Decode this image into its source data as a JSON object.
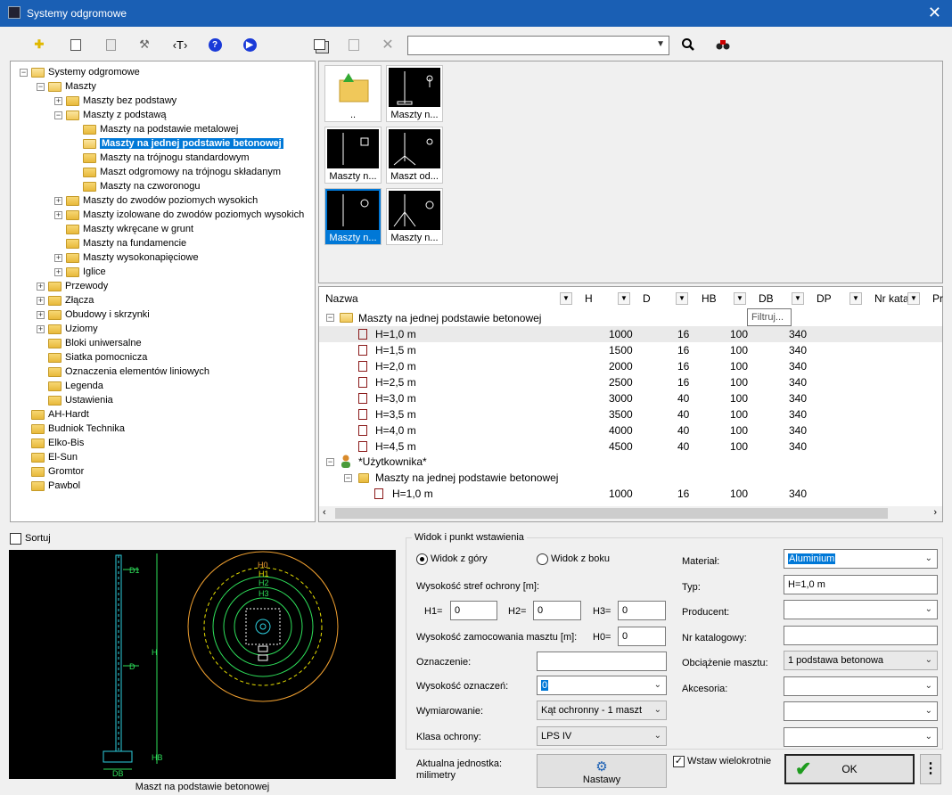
{
  "window": {
    "title": "Systemy odgromowe",
    "close": "✕"
  },
  "toolbar": {
    "add": "✚",
    "tag": "‹T›",
    "help": "?",
    "play": "▶",
    "search_value": "",
    "search_icon": "🔍",
    "binoculars": "🔭"
  },
  "tree": [
    {
      "label": "Systemy odgromowe"
    },
    {
      "label": "Maszty"
    },
    {
      "label": "Maszty bez podstawy"
    },
    {
      "label": "Maszty z podstawą"
    },
    {
      "label": "Maszty na podstawie metalowej"
    },
    {
      "label": "Maszty na jednej podstawie betonowej"
    },
    {
      "label": "Maszty na trójnogu standardowym"
    },
    {
      "label": "Maszt odgromowy na trójnogu składanym"
    },
    {
      "label": "Maszty na czworonogu"
    },
    {
      "label": "Maszty do zwodów poziomych wysokich"
    },
    {
      "label": "Maszty izolowane do zwodów poziomych wysokich"
    },
    {
      "label": "Maszty wkręcane w grunt"
    },
    {
      "label": "Maszty na fundamencie"
    },
    {
      "label": "Maszty wysokonapięciowe"
    },
    {
      "label": "Iglice"
    },
    {
      "label": "Przewody"
    },
    {
      "label": "Złącza"
    },
    {
      "label": "Obudowy i skrzynki"
    },
    {
      "label": "Uziomy"
    },
    {
      "label": "Bloki uniwersalne"
    },
    {
      "label": "Siatka pomocnicza"
    },
    {
      "label": "Oznaczenia elementów liniowych"
    },
    {
      "label": "Legenda"
    },
    {
      "label": "Ustawienia"
    },
    {
      "label": "AH-Hardt"
    },
    {
      "label": "Budniok Technika"
    },
    {
      "label": "Elko-Bis"
    },
    {
      "label": "El-Sun"
    },
    {
      "label": "Gromtor"
    },
    {
      "label": "Pawbol"
    }
  ],
  "thumbnails": [
    "..",
    "Maszty n...",
    "Maszty n...",
    "Maszt od...",
    "Maszty n...",
    "Maszty n..."
  ],
  "grid": {
    "columns": [
      "Nazwa",
      "H",
      "D",
      "HB",
      "DB",
      "DP",
      "Nr kata",
      "Pr"
    ],
    "tooltip": "Filtruj...",
    "group": "Maszty na jednej podstawie betonowej",
    "rows": [
      {
        "name": "H=1,0 m",
        "h": "1000",
        "d": "16",
        "hb": "100",
        "db": "340"
      },
      {
        "name": "H=1,5 m",
        "h": "1500",
        "d": "16",
        "hb": "100",
        "db": "340"
      },
      {
        "name": "H=2,0 m",
        "h": "2000",
        "d": "16",
        "hb": "100",
        "db": "340"
      },
      {
        "name": "H=2,5 m",
        "h": "2500",
        "d": "16",
        "hb": "100",
        "db": "340"
      },
      {
        "name": "H=3,0 m",
        "h": "3000",
        "d": "40",
        "hb": "100",
        "db": "340"
      },
      {
        "name": "H=3,5 m",
        "h": "3500",
        "d": "40",
        "hb": "100",
        "db": "340"
      },
      {
        "name": "H=4,0 m",
        "h": "4000",
        "d": "40",
        "hb": "100",
        "db": "340"
      },
      {
        "name": "H=4,5 m",
        "h": "4500",
        "d": "40",
        "hb": "100",
        "db": "340"
      }
    ],
    "user_group": "*Użytkownika*",
    "user_sub": "Maszty na jednej podstawie betonowej",
    "user_row": {
      "name": "H=1,0 m",
      "h": "1000",
      "d": "16",
      "hb": "100",
      "db": "340"
    }
  },
  "sort_label": "Sortuj",
  "preview": {
    "caption": "Maszt na podstawie betonowej",
    "labels": {
      "d1": "D1",
      "d": "D",
      "h": "H",
      "hb": "HB",
      "db": "DB",
      "h0": "H0",
      "h1": "H1",
      "h2": "H2",
      "h3": "H3"
    }
  },
  "form": {
    "group_title": "Widok i punkt wstawienia",
    "radio_top": "Widok z góry",
    "radio_side": "Widok z boku",
    "zones_label": "Wysokość stref ochrony [m]:",
    "h1_label": "H1=",
    "h1": "0",
    "h2_label": "H2=",
    "h2": "0",
    "h3_label": "H3=",
    "h3": "0",
    "mount_label": "Wysokość zamocowania masztu [m]:",
    "h0_label": "H0=",
    "h0": "0",
    "oznaczenie_label": "Oznaczenie:",
    "oznaczenie": "",
    "wys_ozn_label": "Wysokość oznaczeń:",
    "wys_ozn": "0",
    "wymiar_label": "Wymiarowanie:",
    "wymiar": "Kąt ochronny - 1 maszt",
    "klasa_label": "Klasa ochrony:",
    "klasa": "LPS IV",
    "material_label": "Materiał:",
    "material": "Aluminium",
    "typ_label": "Typ:",
    "typ": "H=1,0 m",
    "producent_label": "Producent:",
    "producent": "",
    "nr_kat_label": "Nr katalogowy:",
    "nr_kat": "",
    "obc_label": "Obciążenie masztu:",
    "obc": "1 podstawa betonowa",
    "akcesoria_label": "Akcesoria:",
    "akcesoria": "",
    "extra1": "",
    "extra2": "",
    "unit_label": "Aktualna jednostka:",
    "unit_value": "milimetry",
    "nastawy": "Nastawy",
    "wstaw_label": "Wstaw wielokrotnie",
    "ok": "OK",
    "more": "⋮"
  }
}
